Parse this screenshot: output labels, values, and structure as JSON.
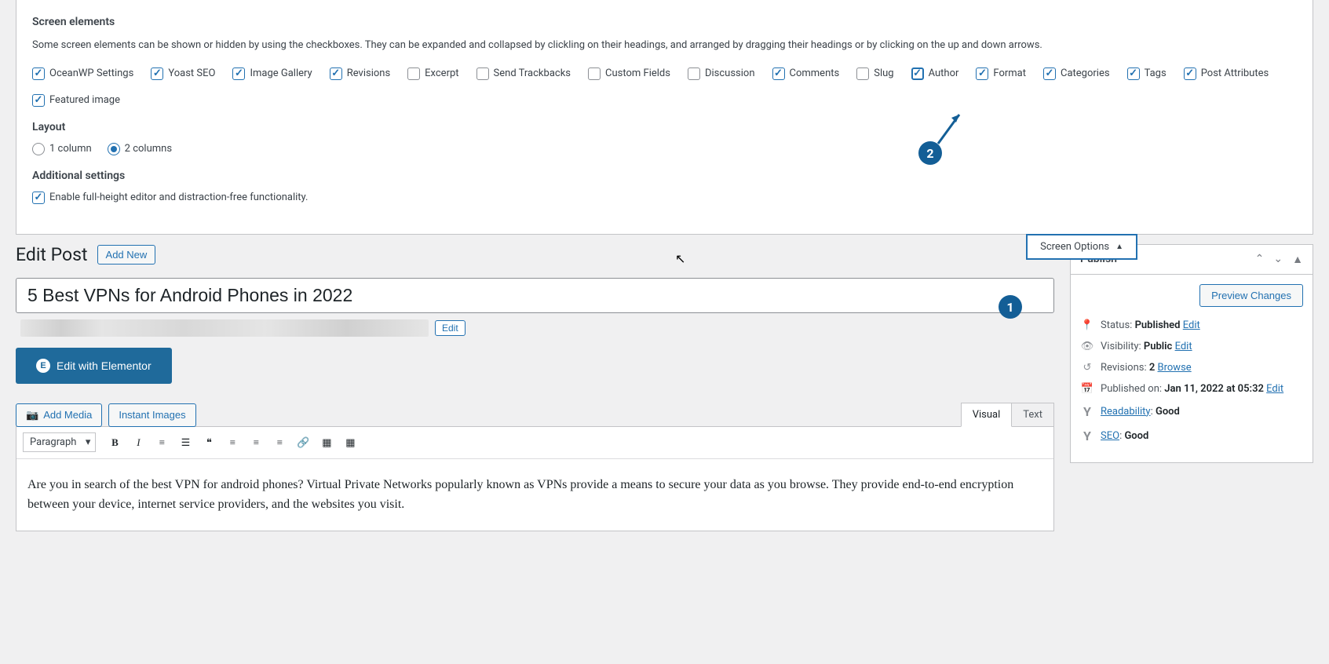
{
  "screen_elements": {
    "heading": "Screen elements",
    "description": "Some screen elements can be shown or hidden by using the checkboxes. They can be expanded and collapsed by clickling on their headings, and arranged by dragging their headings or by clicking on the up and down arrows.",
    "checkboxes": [
      {
        "label": "OceanWP Settings",
        "checked": true
      },
      {
        "label": "Yoast SEO",
        "checked": true
      },
      {
        "label": "Image Gallery",
        "checked": true
      },
      {
        "label": "Revisions",
        "checked": true
      },
      {
        "label": "Excerpt",
        "checked": false
      },
      {
        "label": "Send Trackbacks",
        "checked": false
      },
      {
        "label": "Custom Fields",
        "checked": false
      },
      {
        "label": "Discussion",
        "checked": false
      },
      {
        "label": "Comments",
        "checked": true
      },
      {
        "label": "Slug",
        "checked": false
      },
      {
        "label": "Author",
        "checked": true,
        "highlight": true
      },
      {
        "label": "Format",
        "checked": true
      },
      {
        "label": "Categories",
        "checked": true
      },
      {
        "label": "Tags",
        "checked": true
      },
      {
        "label": "Post Attributes",
        "checked": true
      },
      {
        "label": "Featured image",
        "checked": true
      }
    ]
  },
  "layout": {
    "heading": "Layout",
    "options": [
      {
        "label": "1 column",
        "checked": false
      },
      {
        "label": "2 columns",
        "checked": true
      }
    ]
  },
  "additional": {
    "heading": "Additional settings",
    "checkbox": {
      "label": "Enable full-height editor and distraction-free functionality.",
      "checked": true
    }
  },
  "screen_options_tab": "Screen Options",
  "page": {
    "title": "Edit Post",
    "add_new": "Add New"
  },
  "post": {
    "title": "5 Best VPNs for Android Phones in 2022",
    "edit_permalink": "Edit",
    "elementor_btn": "Edit with Elementor",
    "add_media": "Add Media",
    "instant_images": "Instant Images",
    "tabs": {
      "visual": "Visual",
      "text": "Text"
    },
    "format_select": "Paragraph",
    "content": "Are you in search of the best VPN for android phones? Virtual Private Networks popularly known as VPNs provide a means to secure your data as you browse. They provide end-to-end encryption between your device, internet service providers, and the websites you visit."
  },
  "publish": {
    "title": "Publish",
    "preview": "Preview Changes",
    "status_label": "Status:",
    "status_value": "Published",
    "status_edit": "Edit",
    "visibility_label": "Visibility:",
    "visibility_value": "Public",
    "visibility_edit": "Edit",
    "revisions_label": "Revisions:",
    "revisions_value": "2",
    "revisions_browse": "Browse",
    "published_label": "Published on:",
    "published_value": "Jan 11, 2022 at 05:32",
    "published_edit": "Edit",
    "readability_label": "Readability",
    "readability_value": "Good",
    "seo_label": "SEO",
    "seo_value": "Good"
  },
  "annotations": {
    "one": "1",
    "two": "2"
  }
}
